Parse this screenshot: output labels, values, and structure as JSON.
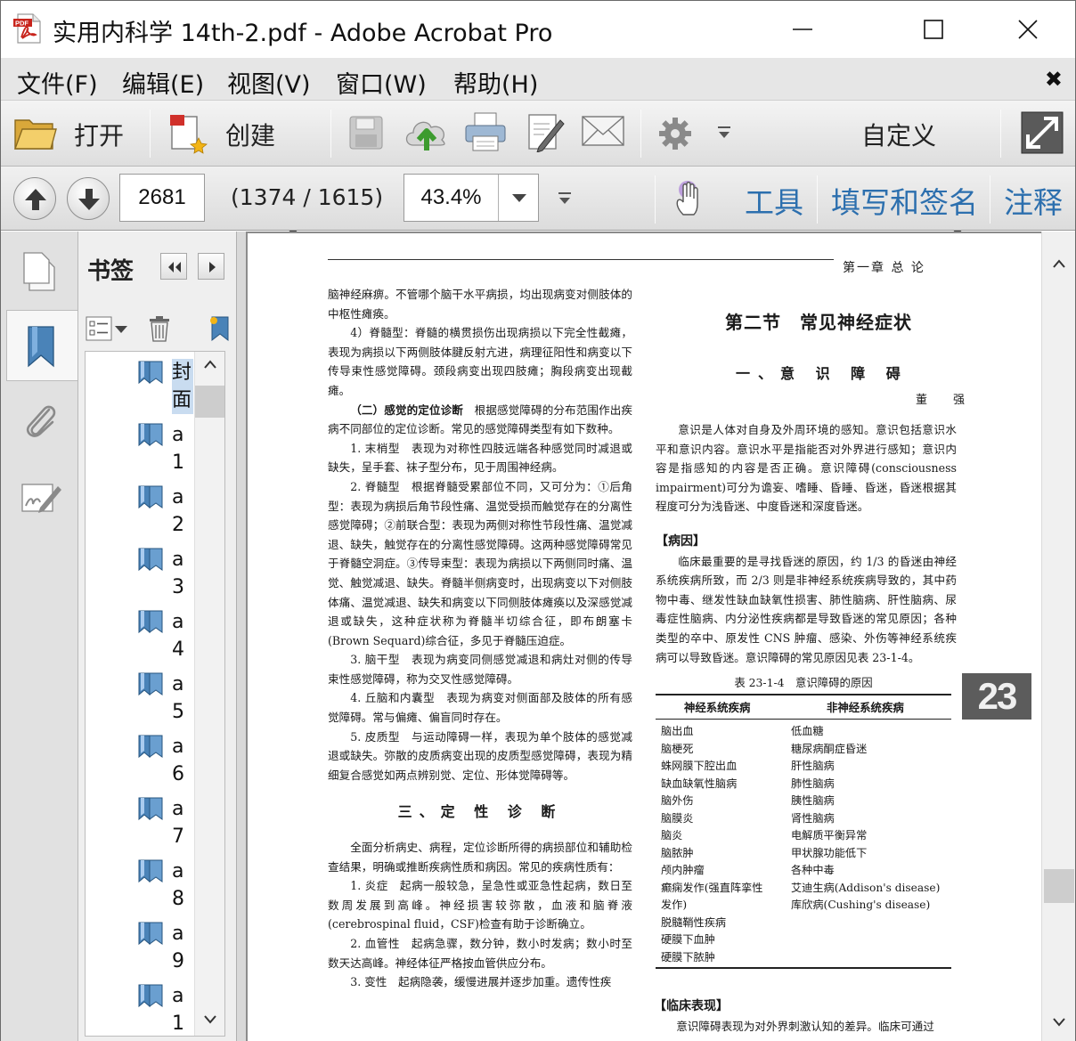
{
  "window": {
    "title": "实用内科学 14th-2.pdf - Adobe Acrobat Pro",
    "app_icon": "pdf-file-icon",
    "minimize_icon": "minimize-icon",
    "maximize_icon": "maximize-icon",
    "close_icon": "close-icon"
  },
  "menu": {
    "items": [
      "文件(F)",
      "编辑(E)",
      "视图(V)",
      "窗口(W)",
      "帮助(H)"
    ],
    "close_label": "✖"
  },
  "toolbar": {
    "open_label": "打开",
    "create_label": "创建",
    "customize_label": "自定义",
    "icons": [
      "folder-icon",
      "create-pdf-icon",
      "save-icon",
      "cloud-upload-icon",
      "print-icon",
      "edit-sign-icon",
      "email-icon",
      "gear-icon",
      "expand-icon"
    ]
  },
  "nav": {
    "page_number": "2681",
    "page_count": "(1374 / 1615)",
    "zoom": "43.4%",
    "tools_label": "工具",
    "fill_sign_label": "填写和签名",
    "comment_label": "注释"
  },
  "bookmarks": {
    "title": "书签",
    "items": [
      {
        "label": "封面",
        "selected": true
      },
      {
        "label": "a1"
      },
      {
        "label": "a2"
      },
      {
        "label": "a3"
      },
      {
        "label": "a4"
      },
      {
        "label": "a5"
      },
      {
        "label": "a6"
      },
      {
        "label": "a7"
      },
      {
        "label": "a8"
      },
      {
        "label": "a9"
      },
      {
        "label": "a1"
      }
    ]
  },
  "page": {
    "header": "第一章  总    论",
    "left_col": {
      "p1": "脑神经麻痹。不管哪个脑干水平病损，均出现病变对侧肢体的中枢性瘫痪。",
      "p2": "4）脊髓型：脊髓的横贯损伤出现病损以下完全性截瘫，表现为病损以下两侧肢体腱反射亢进，病理征阳性和病变以下传导束性感觉障碍。颈段病变出现四肢瘫；胸段病变出现截瘫。",
      "p3_head": "（二）感觉的定位诊断",
      "p3": "根据感觉障碍的分布范围作出疾病不同部位的定位诊断。常见的感觉障碍类型有如下数种。",
      "p4": "1. 末梢型　表现为对称性四肢远端各种感觉同时减退或缺失，呈手套、袜子型分布，见于周围神经病。",
      "p5": "2. 脊髓型　根据脊髓受累部位不同，又可分为：①后角型：表现为病损后角节段性痛、温觉受损而触觉存在的分离性感觉障碍；②前联合型：表现为两侧对称性节段性痛、温觉减退、缺失，触觉存在的分离性感觉障碍。这两种感觉障碍常见于脊髓空洞症。③传导束型：表现为病损以下两侧同时痛、温觉、触觉减退、缺失。脊髓半侧病变时，出现病变以下对侧肢体痛、温觉减退、缺失和病变以下同侧肢体瘫痪以及深感觉减退或缺失，这种症状称为脊髓半切综合征，即布朗塞卡(Brown Sequard)综合征，多见于脊髓压迫症。",
      "p6": "3. 脑干型　表现为病变同侧感觉减退和病灶对侧的传导束性感觉障碍，称为交叉性感觉障碍。",
      "p7": "4. 丘脑和内囊型　表现为病变对侧面部及肢体的所有感觉障碍。常与偏瘫、偏盲同时存在。",
      "p8": "5. 皮质型　与运动障碍一样，表现为单个肢体的感觉减退或缺失。弥散的皮质病变出现的皮质型感觉障碍，表现为精细复合感觉如两点辨别觉、定位、形体觉障碍等。",
      "h3": "三、定 性 诊 断",
      "p9": "全面分析病史、病程，定位诊断所得的病损部位和辅助检查结果，明确或推断疾病性质和病因。常见的疾病性质有：",
      "p10": "1. 炎症　起病一般较急，呈急性或亚急性起病，数日至数周发展到高峰。神经损害较弥散，血液和脑脊液(cerebrospinal fluid，CSF)检查有助于诊断确立。",
      "p11": "2. 血管性　起病急骤，数分钟，数小时发病；数小时至数天达高峰。神经体征严格按血管供应分布。",
      "p12": "3. 变性　起病隐袭，缓慢进展并逐步加重。遗传性疾"
    },
    "right_col": {
      "h1": "第二节　常见神经症状",
      "h2": "一、意 识 障 碍",
      "author": "董　强",
      "p1": "意识是人体对自身及外周环境的感知。意识包括意识水平和意识内容。意识水平是指能否对外界进行感知；意识内容是指感知的内容是否正确。意识障碍(consciousness impairment)可分为谵妄、嗜睡、昏睡、昏迷，昏迷根据其程度可分为浅昏迷、中度昏迷和深度昏迷。",
      "bh1": "【病因】",
      "p2": "临床最重要的是寻找昏迷的原因，约 1/3 的昏迷由神经系统疾病所致，而 2/3 则是非神经系统疾病导致的，其中药物中毒、继发性缺血缺氧性损害、肺性脑病、肝性脑病、尿毒症性脑病、内分泌性疾病都是导致昏迷的常见原因；各种类型的卒中、原发性 CNS 肿瘤、感染、外伤等神经系统疾病可以导致昏迷。意识障碍的常见原因见表 23-1-4。",
      "table_caption": "表 23-1-4　意识障碍的原因",
      "table_headers": [
        "神经系统疾病",
        "非神经系统疾病"
      ],
      "table_col1": [
        "脑出血",
        "脑梗死",
        "蛛网膜下腔出血",
        "缺血缺氧性脑病",
        "脑外伤",
        "脑膜炎",
        "脑炎",
        "脑脓肿",
        "颅内肿瘤",
        "癫痫发作(强直阵挛性",
        "发作)",
        "脱髓鞘性疾病",
        "硬膜下血肿",
        "硬膜下脓肿"
      ],
      "table_col2": [
        "低血糖",
        "糖尿病酮症昏迷",
        "肝性脑病",
        "肺性脑病",
        "胰性脑病",
        "肾性脑病",
        "电解质平衡异常",
        "甲状腺功能低下",
        "各种中毒",
        "艾迪生病(Addison's disease)",
        "库欣病(Cushing's disease)"
      ],
      "bh2": "【临床表现】",
      "p3": "意识障碍表现为对外界刺激认知的差异。临床可通过"
    },
    "chapter_tab": "23"
  }
}
